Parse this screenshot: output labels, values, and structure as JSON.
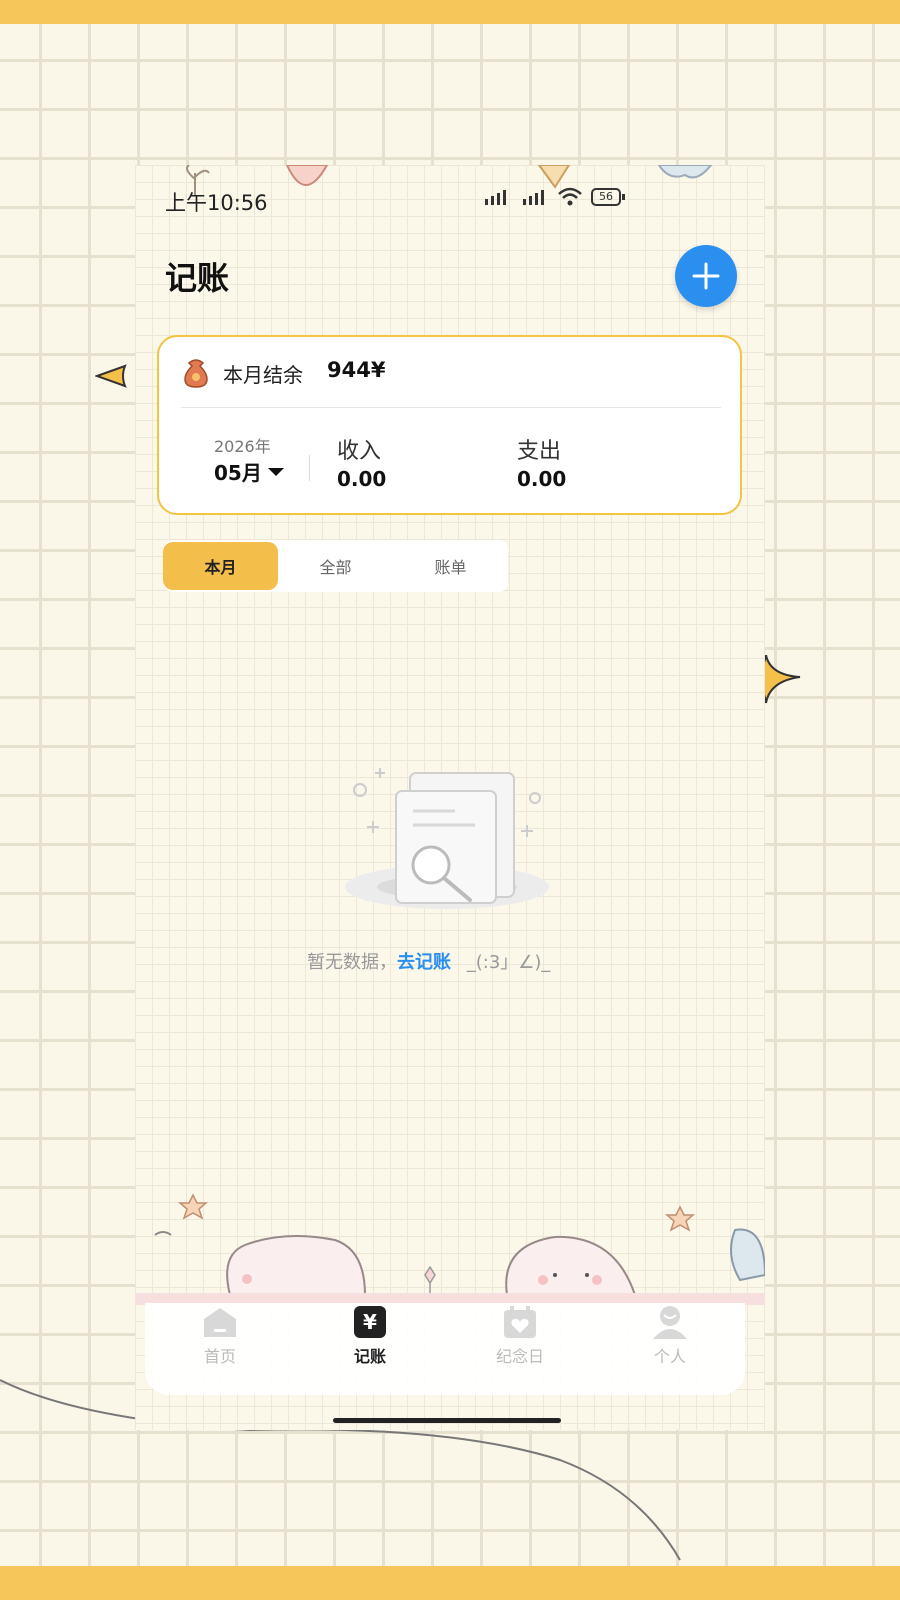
{
  "status_bar": {
    "time": "上午10:56",
    "battery": "56"
  },
  "header": {
    "title": "记账"
  },
  "summary": {
    "balance_label": "本月结余",
    "balance_value": "944¥",
    "year": "2026年",
    "month": "05月",
    "income_label": "收入",
    "income_value": "0.00",
    "expense_label": "支出",
    "expense_value": "0.00"
  },
  "tabs": [
    {
      "label": "本月",
      "active": true
    },
    {
      "label": "全部",
      "active": false
    },
    {
      "label": "账单",
      "active": false
    }
  ],
  "empty_state": {
    "text": "暂无数据，",
    "link": "去记账",
    "emoticon": "_(:3」∠)_"
  },
  "nav": [
    {
      "label": "首页",
      "icon": "home-icon",
      "active": false
    },
    {
      "label": "记账",
      "icon": "yen-icon",
      "active": true
    },
    {
      "label": "纪念日",
      "icon": "calendar-heart-icon",
      "active": false
    },
    {
      "label": "个人",
      "icon": "person-icon",
      "active": false
    }
  ],
  "colors": {
    "accent_yellow": "#f4be4a",
    "accent_blue": "#2b8ff0",
    "card_border": "#f2c443"
  }
}
